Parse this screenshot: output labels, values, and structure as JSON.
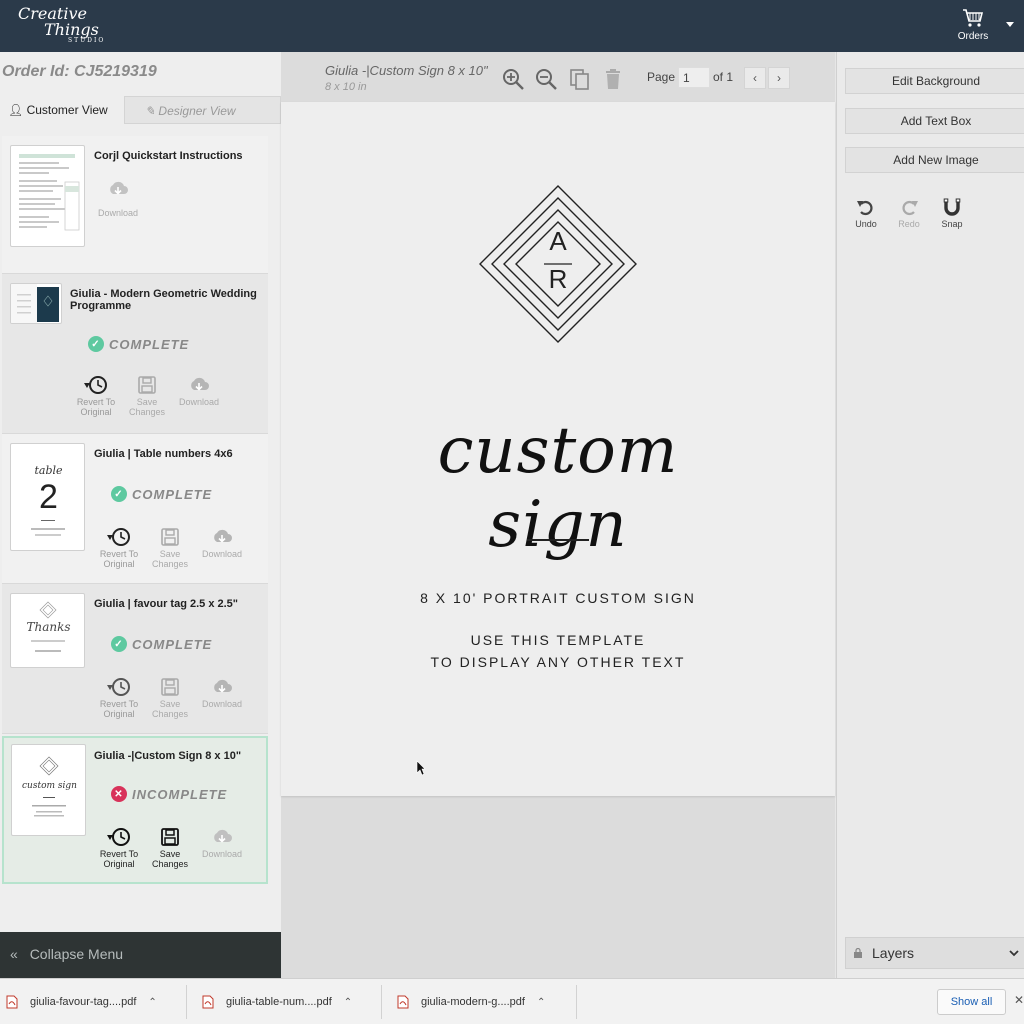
{
  "brand": {
    "line1": "Creative",
    "line2": "Things",
    "line3": "STUDIO"
  },
  "header": {
    "orders_label": "Orders"
  },
  "left": {
    "order_id": "Order Id: CJ5219319",
    "tabs": {
      "customer": "Customer View",
      "designer": "Designer View"
    },
    "items": [
      {
        "title": "Corjl Quickstart Instructions",
        "download": "Download"
      },
      {
        "title": "Giulia - Modern Geometric Wedding Programme",
        "status": "COMPLETE",
        "revert": "Revert To Original",
        "save": "Save Changes",
        "download": "Download"
      },
      {
        "title": "Giulia | Table numbers 4x6",
        "status": "COMPLETE",
        "revert": "Revert To Original",
        "save": "Save Changes",
        "download": "Download",
        "thumb_word": "table",
        "thumb_num": "2"
      },
      {
        "title": "Giulia | favour tag 2.5 x 2.5\"",
        "status": "COMPLETE",
        "revert": "Revert To Original",
        "save": "Save Changes",
        "download": "Download",
        "thumb_word": "Thanks"
      },
      {
        "title": "Giulia -|Custom Sign 8 x 10\"",
        "status": "INCOMPLETE",
        "revert": "Revert To Original",
        "save": "Save Changes",
        "download": "Download",
        "thumb_word": "custom sign"
      }
    ],
    "collapse_label": "Collapse Menu"
  },
  "editor": {
    "doc_title": "Giulia -|Custom Sign 8 x 10\"",
    "doc_size": "8 x 10 in",
    "page_label": "Page",
    "page_value": "1",
    "page_of": "of 1",
    "sign": {
      "monogram_top": "A",
      "monogram_bottom": "R",
      "script": "custom sign",
      "line1": "8 X 10' PORTRAIT CUSTOM SIGN",
      "line2": "USE THIS TEMPLATE",
      "line3": "TO DISPLAY ANY OTHER TEXT"
    }
  },
  "right": {
    "edit_background": "Edit Background",
    "add_text_box": "Add Text Box",
    "add_new_image": "Add New Image",
    "undo": "Undo",
    "redo": "Redo",
    "snap": "Snap",
    "layers": "Layers"
  },
  "downloads": {
    "files": [
      "giulia-favour-tag....pdf",
      "giulia-table-num....pdf",
      "giulia-modern-g....pdf"
    ],
    "show_all": "Show all"
  },
  "colors": {
    "topbar": "#2b3a4a",
    "complete": "#5ec9a0",
    "incomplete": "#d8325a",
    "active_border": "#b6e3cd",
    "link": "#1a5fb4"
  },
  "icons": [
    "cart-icon",
    "zoom-in-icon",
    "zoom-out-icon",
    "copy-icon",
    "trash-icon",
    "download-cloud-icon",
    "revert-clock-icon",
    "save-disk-icon",
    "check-icon",
    "x-icon",
    "undo-icon",
    "redo-icon",
    "magnet-icon",
    "lock-icon",
    "chevron-down-icon",
    "pdf-file-icon"
  ]
}
